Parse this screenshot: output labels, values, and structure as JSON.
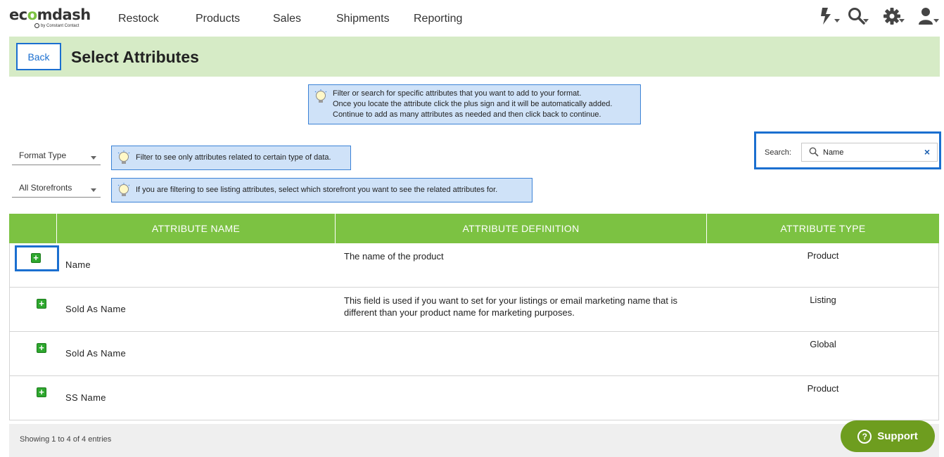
{
  "app": {
    "logo_text_1": "ec",
    "logo_text_2": "o",
    "logo_text_3": "mdash",
    "logo_sub": "by Constant Contact"
  },
  "nav": {
    "items": [
      "Restock",
      "Products",
      "Sales",
      "Shipments",
      "Reporting"
    ]
  },
  "nav_icons": [
    "lightning-icon",
    "search-icon",
    "gear-icon",
    "user-icon"
  ],
  "header": {
    "back_label": "Back",
    "title": "Select Attributes"
  },
  "info": {
    "main_lines": [
      "Filter or search for specific attributes that you want to add to your format.",
      "Once you locate the attribute click the plus sign and it will be automatically added.",
      "Continue to add as many attributes as needed and then click back to continue."
    ],
    "format_hint": "Filter to see only attributes related to certain type of data.",
    "storefront_hint": "If you are filtering to see listing attributes, select which storefront you want to see the related attributes for."
  },
  "filters": {
    "format_type": "Format Type",
    "storefronts": "All Storefronts"
  },
  "search": {
    "label": "Search:",
    "value": "Name",
    "clear": "×"
  },
  "table": {
    "headers": [
      "",
      "ATTRIBUTE NAME",
      "ATTRIBUTE DEFINITION",
      "ATTRIBUTE TYPE"
    ],
    "add_symbol": "+",
    "rows": [
      {
        "name": "Name",
        "definition": "The name of the product",
        "type": "Product"
      },
      {
        "name": "Sold As Name",
        "definition": "This field is used if you want to set for your listings or email marketing name that is different than your product name for marketing purposes.",
        "type": "Listing"
      },
      {
        "name": "Sold As Name",
        "definition": "",
        "type": "Global"
      },
      {
        "name": "SS Name",
        "definition": "",
        "type": "Product"
      }
    ],
    "footer_info": "Showing 1 to 4 of 4 entries"
  },
  "support": {
    "label": "Support",
    "icon_text": "?"
  },
  "colors": {
    "brand_green": "#7cc242",
    "header_bg": "#d6ebc6",
    "info_bg": "#cfe2f8",
    "focus_blue": "#1b6fd0",
    "support_bg": "#6e9d1f"
  }
}
